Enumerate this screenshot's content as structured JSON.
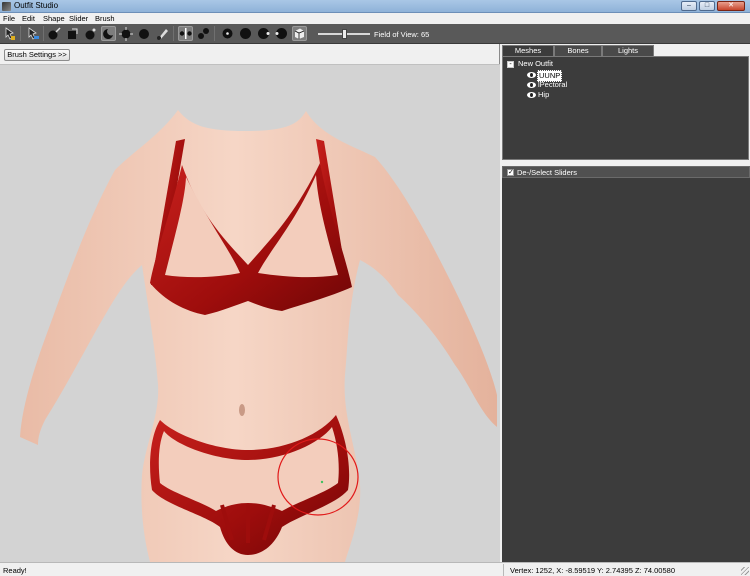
{
  "window": {
    "title": "Outfit Studio",
    "controls": {
      "minimize": "–",
      "maximize": "□",
      "close": "✕"
    }
  },
  "menu": [
    "File",
    "Edit",
    "Shape",
    "Slider",
    "Brush"
  ],
  "toolbar": {
    "field_of_view_label": "Field of View: 65",
    "field_of_view_value": 65,
    "icons": [
      "select-tool-icon",
      "transform-tool-icon",
      "mask-brush-icon",
      "inflate-brush-icon",
      "deflate-brush-icon",
      "move-brush-icon",
      "smooth-brush-icon",
      "weight-brush-icon",
      "color-brush-icon",
      "mirror-toggle-icon",
      "connected-toggle-icon",
      "sphere-small-icon",
      "sphere-medium-icon",
      "sphere-large-icon",
      "sphere-xlarge-icon",
      "cube-view-icon"
    ]
  },
  "left_panel": {
    "brush_settings_label": "Brush Settings >>"
  },
  "right_panel": {
    "tabs": [
      "Meshes",
      "Bones",
      "Lights"
    ],
    "selected_tab": "Meshes",
    "tree": {
      "root": "New Outfit",
      "expander": "-",
      "items": [
        {
          "label": "UUNP",
          "selected": true
        },
        {
          "label": "lPectoral",
          "selected": false
        },
        {
          "label": "Hip",
          "selected": false
        }
      ]
    },
    "sliders_header": "De-/Select Sliders",
    "sliders_checked": true
  },
  "status": {
    "left": "Ready!",
    "right": "Vertex: 1252, X: -8.59519 Y: 2.74395 Z: 74.00580"
  },
  "colors": {
    "toolbar": "#595959",
    "viewport_bg": "#d3d3d3",
    "panel_dark": "#3c3c3c",
    "outfit_red": "#a8100f",
    "skin": "#f2cdbb",
    "brush_circle": "#e11a1a"
  }
}
